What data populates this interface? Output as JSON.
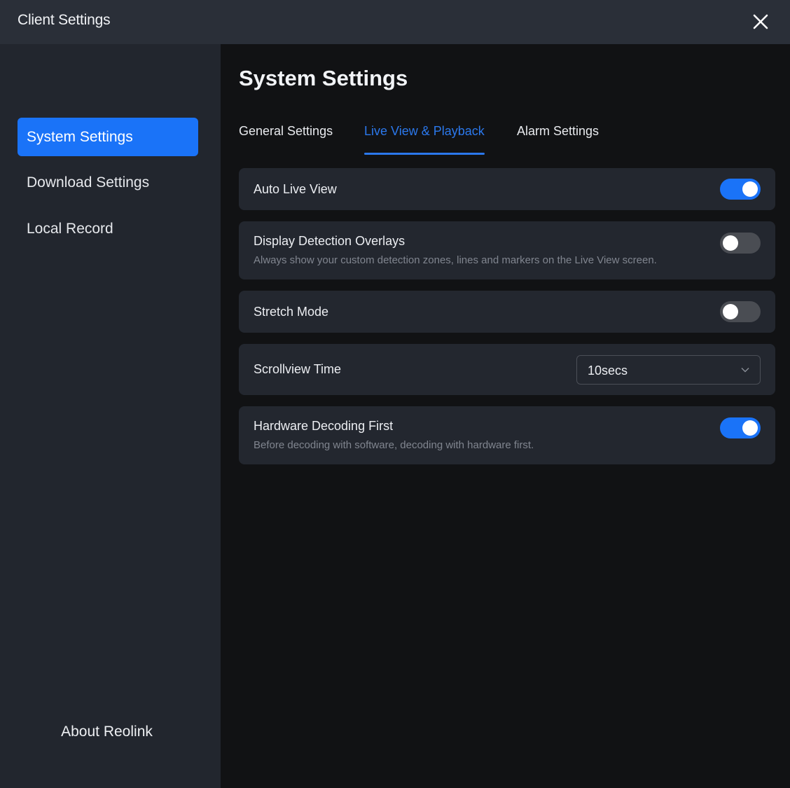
{
  "window": {
    "title": "Client Settings"
  },
  "sidebar": {
    "items": [
      {
        "label": "System Settings",
        "active": true
      },
      {
        "label": "Download Settings",
        "active": false
      },
      {
        "label": "Local Record",
        "active": false
      }
    ],
    "about_label": "About Reolink"
  },
  "main": {
    "title": "System Settings",
    "tabs": [
      {
        "label": "General Settings",
        "active": false
      },
      {
        "label": "Live View & Playback",
        "active": true
      },
      {
        "label": "Alarm Settings",
        "active": false
      }
    ],
    "settings": {
      "auto_live_view": {
        "label": "Auto Live View",
        "enabled": true
      },
      "display_detection_overlays": {
        "label": "Display Detection Overlays",
        "description": "Always show your custom detection zones, lines and markers on the Live View screen.",
        "enabled": false
      },
      "stretch_mode": {
        "label": "Stretch Mode",
        "enabled": false
      },
      "scrollview_time": {
        "label": "Scrollview Time",
        "value": "10secs"
      },
      "hardware_decoding_first": {
        "label": "Hardware Decoding First",
        "description": "Before decoding with software, decoding with hardware first.",
        "enabled": true
      }
    }
  },
  "colors": {
    "accent": "#1a73f8",
    "tab_active": "#2b78ec",
    "toggle_off": "#4a4d53",
    "card_bg": "#23272f",
    "sidebar_bg": "#22262e",
    "main_bg": "#111214",
    "titlebar_bg": "#2a2f38"
  },
  "icons": {
    "close": "close-icon",
    "dropdown": "chevron-down-icon"
  }
}
